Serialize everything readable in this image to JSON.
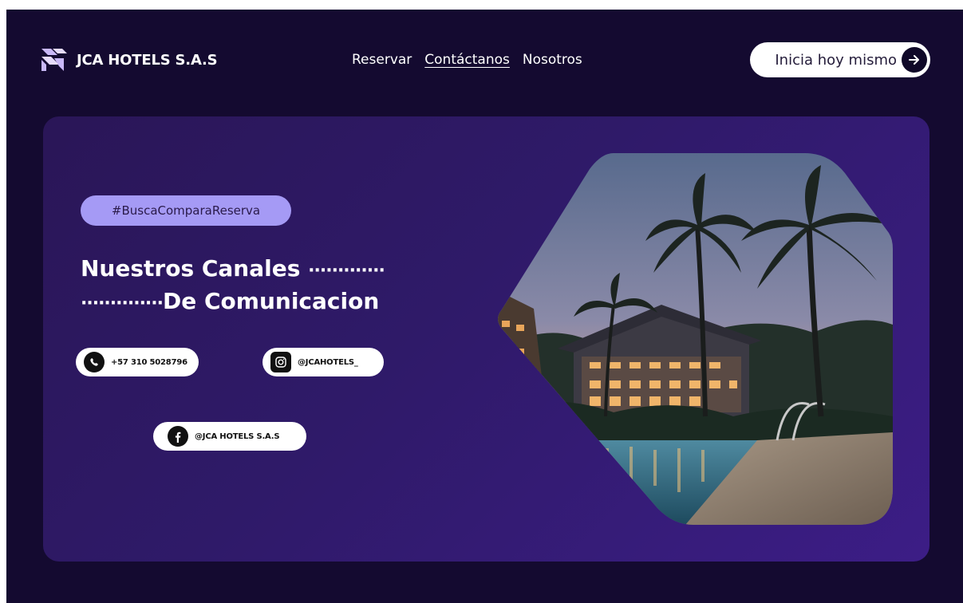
{
  "header": {
    "brand_name": "JCA HOTELS S.A.S",
    "logo_icon": "brand-logo-icon",
    "nav": [
      {
        "label": "Reservar",
        "active": false
      },
      {
        "label": "Contáctanos",
        "active": true
      },
      {
        "label": "Nosotros",
        "active": false
      }
    ],
    "cta_label": "Inicia hoy mismo",
    "cta_icon": "arrow-right-circle-icon"
  },
  "hero": {
    "tag": "#BuscaComparaReserva",
    "heading_line1": "Nuestros  Canales",
    "heading_line1_dots": "·············",
    "heading_line2_dots": "··············",
    "heading_line2": "De Comunicacion",
    "contacts": {
      "whatsapp": {
        "label": "+57 310 5028796",
        "icon": "whatsapp-icon"
      },
      "instagram": {
        "label": "@JCAHOTELS_",
        "icon": "instagram-icon"
      },
      "facebook": {
        "label": "@JCA HOTELS S.A.S",
        "icon": "facebook-icon"
      }
    },
    "image_subject": "resort-pool-palm-trees-dusk"
  },
  "colors": {
    "page_bg": "#140a30",
    "card_bg": "#2f1a69",
    "tag_bg": "#a59af5",
    "logo_accent": "#c9b8f7"
  }
}
